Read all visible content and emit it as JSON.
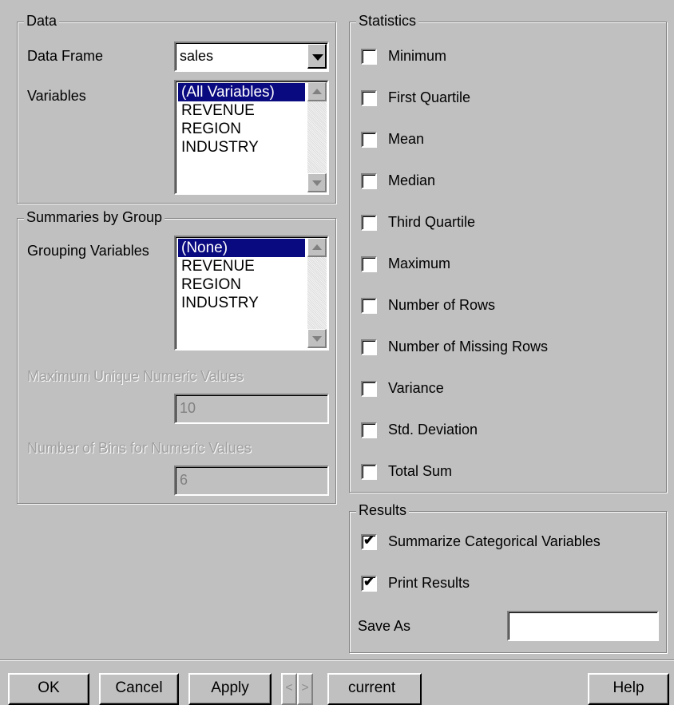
{
  "data_group": {
    "title": "Data",
    "data_frame_label": "Data Frame",
    "data_frame_value": "sales",
    "variables_label": "Variables",
    "variables": [
      "(All Variables)",
      "REVENUE",
      "REGION",
      "INDUSTRY"
    ],
    "variables_selected": "(All Variables)"
  },
  "group_summary": {
    "title": "Summaries by Group",
    "grouping_label": "Grouping Variables",
    "grouping": [
      "(None)",
      "REVENUE",
      "REGION",
      "INDUSTRY"
    ],
    "grouping_selected": "(None)",
    "max_unique_label": "Maximum Unique Numeric Values",
    "max_unique_value": "10",
    "num_bins_label": "Number of Bins for Numeric Values",
    "num_bins_value": "6"
  },
  "statistics": {
    "title": "Statistics",
    "items": [
      {
        "label": "Minimum",
        "checked": false
      },
      {
        "label": "First Quartile",
        "checked": false
      },
      {
        "label": "Mean",
        "checked": false
      },
      {
        "label": "Median",
        "checked": false
      },
      {
        "label": "Third Quartile",
        "checked": false
      },
      {
        "label": "Maximum",
        "checked": false
      },
      {
        "label": "Number of Rows",
        "checked": false
      },
      {
        "label": "Number of Missing Rows",
        "checked": false
      },
      {
        "label": "Variance",
        "checked": false
      },
      {
        "label": "Std. Deviation",
        "checked": false
      },
      {
        "label": "Total Sum",
        "checked": false
      }
    ]
  },
  "results": {
    "title": "Results",
    "summarize_label": "Summarize Categorical Variables",
    "summarize_checked": true,
    "print_label": "Print Results",
    "print_checked": true,
    "save_as_label": "Save As",
    "save_as_value": ""
  },
  "buttons": {
    "ok": "OK",
    "cancel": "Cancel",
    "apply": "Apply",
    "prev": "<",
    "next": ">",
    "current": "current",
    "help": "Help"
  }
}
